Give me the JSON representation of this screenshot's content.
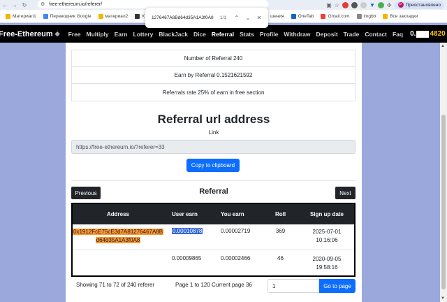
{
  "browser": {
    "url": "free-ethereum.io/referer/",
    "profile_label": "Приостановлено",
    "profile_initial": "P",
    "bookmarks": [
      "Материал1",
      "Переводчик Google",
      "материал2",
      "К",
      "шения",
      "OneTab",
      "Gmail.com",
      "imgbb",
      "Все закладки"
    ],
    "find": {
      "query": "1276467A8Bd64d35A1A3f0A8",
      "count": "1/1"
    }
  },
  "site": {
    "brand": "Free-Ethereum",
    "nav": [
      "Free",
      "Multiply",
      "Earn",
      "Lottery",
      "BlackJack",
      "Dice",
      "Referral",
      "Stats",
      "Profile",
      "Withdraw",
      "Deposit",
      "Trade",
      "Contact",
      "Faq"
    ],
    "balance_prefix": "0.",
    "balance_suffix": "4820"
  },
  "stats": {
    "number_of_referral": "Number of Referral 240",
    "earn_by_referral": "Earn by Referral 0.1521621592",
    "referral_rate": "Referrals rate 25% of earn in free section"
  },
  "referral_url": {
    "title": "Referral url address",
    "link_label": "Link",
    "link_value": "https://free-ethereum.io/?referer=33",
    "copy_label": "Copy to clipboard"
  },
  "referral_table": {
    "title": "Referral",
    "prev_label": "Previous",
    "next_label": "Next",
    "headers": [
      "Address",
      "User earn",
      "You earn",
      "Roll",
      "Sign up date"
    ],
    "rows": [
      {
        "address_line1": "0x1912FcE75cE3d7A81276467A8B",
        "address_line2": "d64d35A1A3f0A8",
        "user_earn": "0.00010878",
        "you_earn": "0.00002719",
        "roll": "369",
        "date": "2025-07-01",
        "time": "10:16:06"
      },
      {
        "address_line1": "",
        "address_line2": "",
        "user_earn": "0.00009865",
        "you_earn": "0.00002466",
        "roll": "46",
        "date": "2020-09-05",
        "time": "19:58:16"
      }
    ]
  },
  "pagination": {
    "showing": "Showing 71 to 72 of 240 referer",
    "pages": "Page 1 to 120 Current page 36",
    "input_value": "1",
    "go_label": "Go to page"
  }
}
